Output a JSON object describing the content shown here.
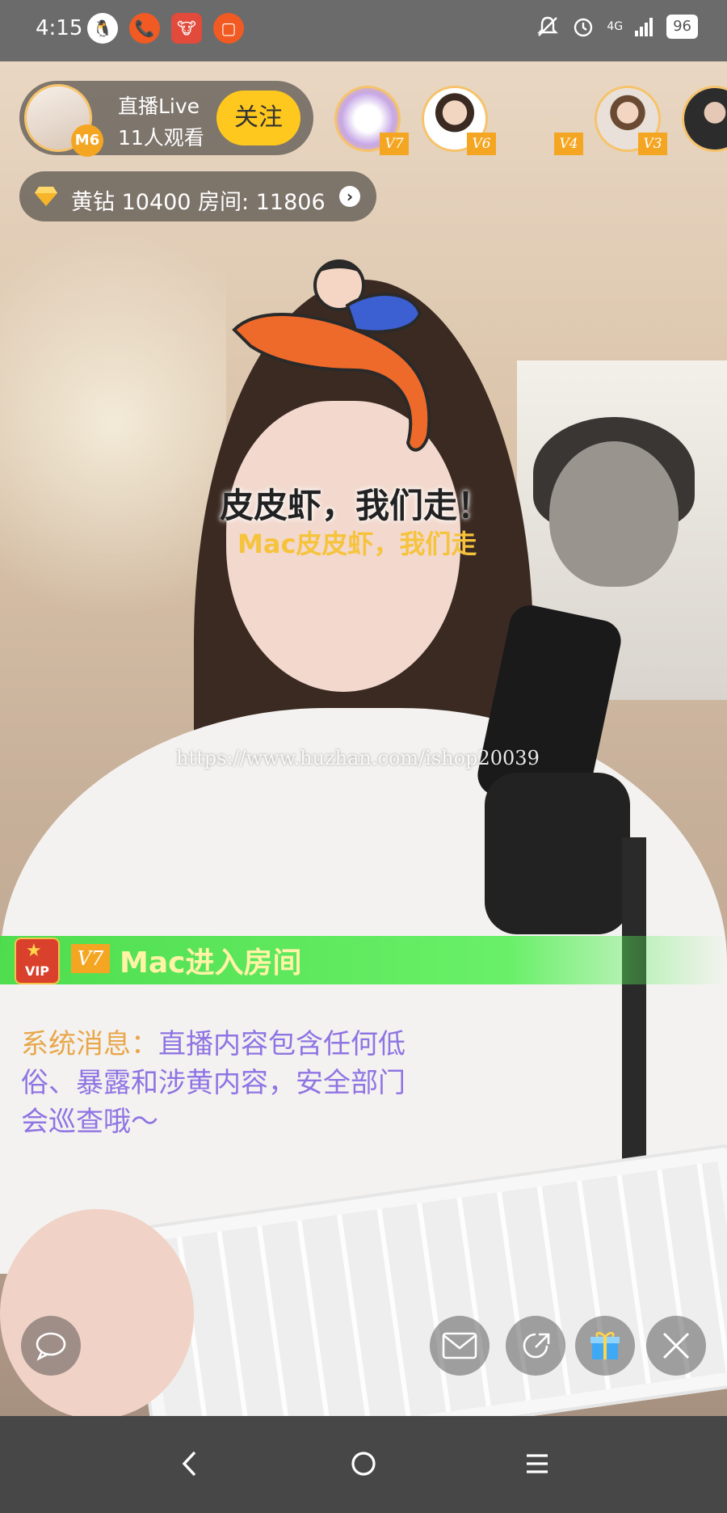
{
  "status_bar": {
    "time": "4:15",
    "network": "4G",
    "battery": "96",
    "icons": [
      "qq-icon",
      "phone-call-icon",
      "cow-app-icon",
      "screen-share-icon",
      "mute-bell-icon",
      "alarm-icon",
      "signal-icon",
      "battery-icon"
    ]
  },
  "host": {
    "title": "直播Live",
    "viewers": "11人观看",
    "level": "M6",
    "follow_label": "关注"
  },
  "viewers": [
    {
      "level": "V7"
    },
    {
      "level": "V6"
    },
    {
      "level": "V4"
    },
    {
      "level": "V3"
    },
    {
      "level": ""
    }
  ],
  "room": {
    "info": "黄钻 10400  房间: 11806"
  },
  "sticker": {
    "title": "皮皮虾，我们走！",
    "subtitle": "Mac皮皮虾，我们走"
  },
  "watermark": "https://www.huzhan.com/ishop20039",
  "enter_banner": {
    "vip_label": "VIP",
    "level": "V7",
    "text": "Mac进入房间"
  },
  "system_message": {
    "label": "系统消息：",
    "text": "直播内容包含任何低俗、暴露和涉黄内容，安全部门会巡查哦～"
  },
  "colors": {
    "follow_button": "#ffc81e",
    "level_badge": "#f4a623",
    "system_label": "#e8a74b",
    "system_text": "#8f74e3",
    "enter_banner": "#46dc46"
  },
  "bottom_actions": [
    "chat-bubble-icon",
    "mail-icon",
    "share-icon",
    "gift-icon",
    "close-icon"
  ],
  "nav": [
    "back-icon",
    "home-icon",
    "menu-icon"
  ]
}
